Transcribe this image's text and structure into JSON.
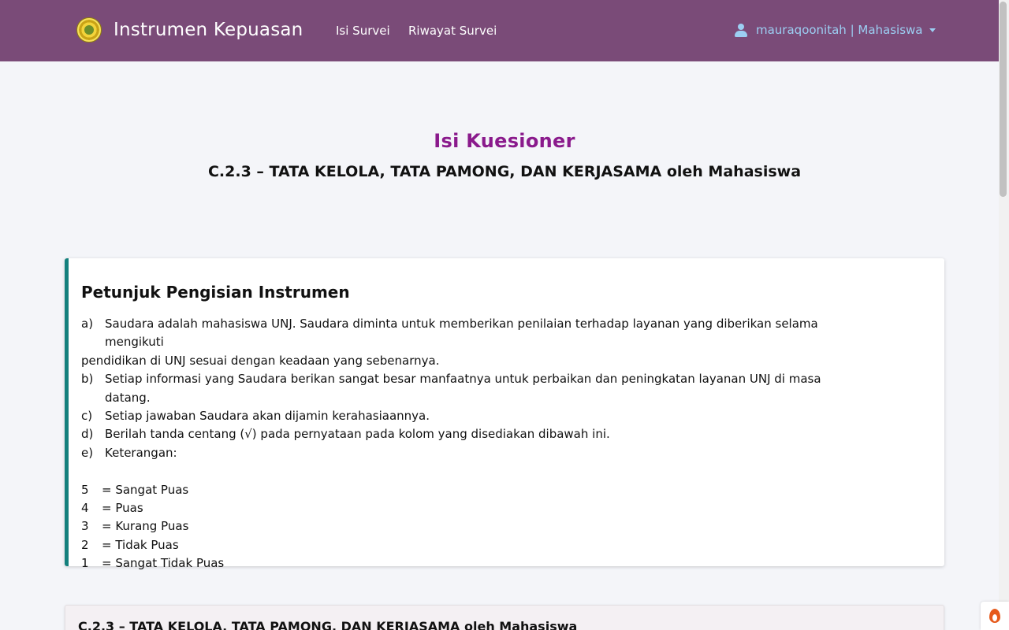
{
  "navbar": {
    "brand": "Instrumen Kepuasan",
    "links": [
      "Isi Survei",
      "Riwayat Survei"
    ],
    "user": "mauraqoonitah | Mahasiswa"
  },
  "header": {
    "title": "Isi Kuesioner",
    "subtitle": "C.2.3 – TATA KELOLA, TATA PAMONG, DAN KERJASAMA oleh Mahasiswa"
  },
  "instructions": {
    "title": "Petunjuk Pengisian Instrumen",
    "items": [
      {
        "key": "a)",
        "text": "Saudara adalah mahasiswa UNJ. Saudara diminta untuk memberikan penilaian terhadap layanan yang diberikan selama mengikuti"
      },
      {
        "key": "",
        "text": "pendidikan di UNJ sesuai dengan keadaan yang sebenarnya."
      },
      {
        "key": "b)",
        "text": "Setiap informasi yang Saudara berikan sangat besar manfaatnya untuk perbaikan dan peningkatan layanan UNJ di masa datang."
      },
      {
        "key": "c)",
        "text": "Setiap jawaban Saudara akan dijamin kerahasiaannya."
      },
      {
        "key": "d)",
        "text": "Berilah tanda centang (√) pada pernyataan pada kolom yang disediakan dibawah ini."
      },
      {
        "key": "e)",
        "text": "Keterangan:"
      }
    ],
    "scale": [
      {
        "num": "5",
        "label": " = Sangat Puas"
      },
      {
        "num": "4",
        "label": "= Puas"
      },
      {
        "num": "3",
        "label": "= Kurang Puas"
      },
      {
        "num": "2",
        "label": "= Tidak Puas"
      },
      {
        "num": "1",
        "label": "= Sangat Tidak Puas"
      }
    ]
  },
  "section": {
    "title": "C.2.3 – TATA KELOLA, TATA PAMONG, DAN KERJASAMA oleh Mahasiswa"
  },
  "colors": {
    "navbar": "#7a4b78",
    "title": "#8a1a8c",
    "card_accent": "#14807d",
    "user_link": "#9ccff3"
  }
}
